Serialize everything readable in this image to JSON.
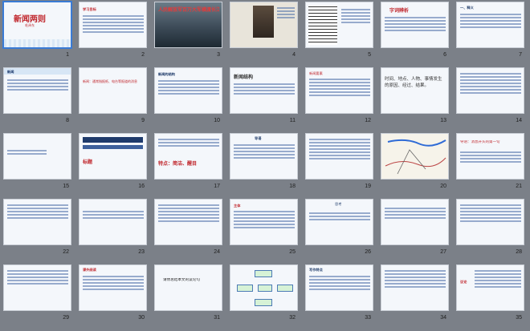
{
  "slides": [
    {
      "number": "1",
      "title": "新闻两则",
      "subtitle": "毛泽东"
    },
    {
      "number": "2",
      "title": "学习目标"
    },
    {
      "number": "3",
      "title": "人民解放军百万大军横渡长江"
    },
    {
      "number": "4",
      "title": ""
    },
    {
      "number": "5",
      "title": ""
    },
    {
      "number": "6",
      "title": "字词辨析"
    },
    {
      "number": "7",
      "title": "一、释义"
    },
    {
      "number": "8",
      "title": "新闻"
    },
    {
      "number": "9",
      "title": "新闻：通常指报纸、电台等报道的消息"
    },
    {
      "number": "10",
      "title": "新闻的结构"
    },
    {
      "number": "11",
      "title": "新闻结构"
    },
    {
      "number": "12",
      "title": "新闻要素"
    },
    {
      "number": "13",
      "title": "时间、地点、人物、事情发生的原因、经过、结果。"
    },
    {
      "number": "14",
      "title": ""
    },
    {
      "number": "15",
      "title": ""
    },
    {
      "number": "16",
      "title": "标题"
    },
    {
      "number": "17",
      "title": "特点：简洁、醒目"
    },
    {
      "number": "18",
      "title": "导语"
    },
    {
      "number": "19",
      "title": ""
    },
    {
      "number": "20",
      "title": "地图"
    },
    {
      "number": "21",
      "title": "导语：消息开头的第一句"
    },
    {
      "number": "22",
      "title": ""
    },
    {
      "number": "23",
      "title": ""
    },
    {
      "number": "24",
      "title": ""
    },
    {
      "number": "25",
      "title": "主体"
    },
    {
      "number": "26",
      "title": "思考"
    },
    {
      "number": "27",
      "title": ""
    },
    {
      "number": "28",
      "title": ""
    },
    {
      "number": "29",
      "title": ""
    },
    {
      "number": "30",
      "title": "课外阅读"
    },
    {
      "number": "31",
      "title": "请你总结本文的议论句"
    },
    {
      "number": "32",
      "title": "结构图"
    },
    {
      "number": "33",
      "title": "写作特点"
    },
    {
      "number": "34",
      "title": ""
    },
    {
      "number": "35",
      "title": "议论"
    }
  ]
}
